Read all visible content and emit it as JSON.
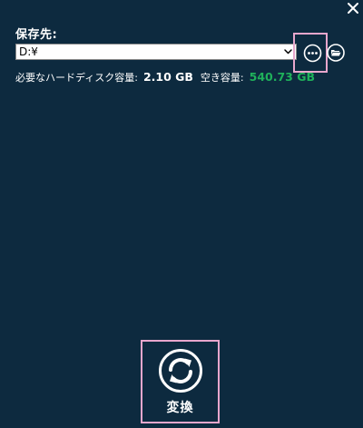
{
  "dialog": {
    "close_icon": "close-icon"
  },
  "destination": {
    "label": "保存先:",
    "path_value": "D:¥",
    "dropdown_icon": "chevron-down-icon",
    "browse_icon": "more-dots-icon",
    "open_folder_icon": "folder-open-icon"
  },
  "disk": {
    "required_label": "必要なハードディスク容量:",
    "required_value": "2.10 GB",
    "free_label": "空き容量:",
    "free_value": "540.73 GB",
    "free_color": "#1fb15b"
  },
  "convert": {
    "label": "変換",
    "icon": "convert-refresh-icon"
  },
  "colors": {
    "background": "#0d2a3f",
    "highlight_border": "#e7a6cc"
  }
}
